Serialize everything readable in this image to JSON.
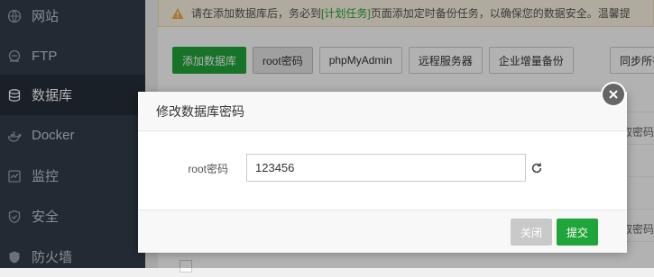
{
  "sidebar": {
    "items": [
      {
        "label": "网站",
        "icon": "globe-icon",
        "active": false
      },
      {
        "label": "FTP",
        "icon": "ftp-icon",
        "active": false
      },
      {
        "label": "数据库",
        "icon": "database-icon",
        "active": true
      },
      {
        "label": "Docker",
        "icon": "docker-icon",
        "active": false
      },
      {
        "label": "监控",
        "icon": "monitor-icon",
        "active": false
      },
      {
        "label": "安全",
        "icon": "shield-icon",
        "active": false
      },
      {
        "label": "防火墙",
        "icon": "firewall-icon",
        "active": false
      }
    ]
  },
  "alert": {
    "icon": "warning-icon",
    "text_before": "请在添加数据库后，务必到",
    "link": "[计划任务]",
    "text_after": "页面添加定时备份任务，以确保您的数据安全。温馨提"
  },
  "toolbar": {
    "buttons": [
      "添加数据库",
      "root密码",
      "phpMyAdmin",
      "远程服务器",
      "企业增量备份"
    ],
    "sync_label": "同步所有"
  },
  "table": {
    "row_fragment_1": "点击获取密码",
    "row_fragment_2": "点击获取密码"
  },
  "modal": {
    "title": "修改数据库密码",
    "field_label": "root密码",
    "field_value": "123456",
    "cancel_label": "关闭",
    "submit_label": "提交"
  },
  "colors": {
    "accent": "#20a53a",
    "sidebar_bg": "#313d4a",
    "warning": "#f0ad4e"
  }
}
